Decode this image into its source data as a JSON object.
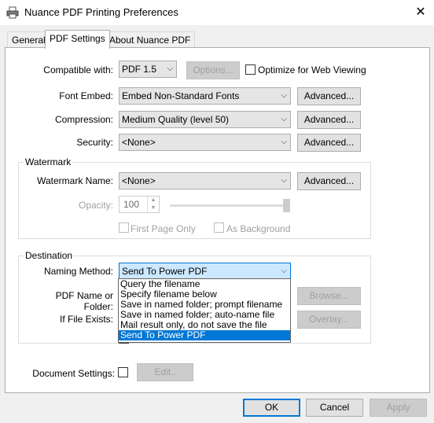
{
  "window": {
    "title": "Nuance PDF Printing Preferences"
  },
  "tabs": [
    "General",
    "PDF Settings",
    "About Nuance PDF"
  ],
  "compatible": {
    "label": "Compatible with:",
    "value": "PDF 1.5",
    "options_btn": "Options...",
    "optimize_label": "Optimize for Web Viewing"
  },
  "font_embed": {
    "label": "Font Embed:",
    "value": "Embed Non-Standard Fonts",
    "btn": "Advanced..."
  },
  "compression": {
    "label": "Compression:",
    "value": "Medium Quality (level 50)",
    "btn": "Advanced..."
  },
  "security": {
    "label": "Security:",
    "value": "<None>",
    "btn": "Advanced..."
  },
  "watermark": {
    "group_title": "Watermark",
    "name_label": "Watermark Name:",
    "name_value": "<None>",
    "btn": "Advanced...",
    "opacity_label": "Opacity:",
    "opacity_value": "100",
    "opacity_slider": 1.0,
    "first_page_label": "First Page Only",
    "background_label": "As Background"
  },
  "destination": {
    "group_title": "Destination",
    "naming_label": "Naming Method:",
    "naming_value": "Send To Power PDF",
    "pdfname_label": "PDF Name or Folder:",
    "browse_btn": "Browse...",
    "exists_label": "If File Exists:",
    "overlay_btn": "Overlay...",
    "options": [
      "Query the filename",
      "Specify filename below",
      "Save in named folder; prompt filename",
      "Save in named folder; auto-name file",
      "Mail result only, do not save the file",
      "Send To Power PDF"
    ],
    "selected_index": 5
  },
  "document_settings": {
    "label": "Document Settings:",
    "edit_btn": "Edit.."
  },
  "footer": {
    "ok": "OK",
    "cancel": "Cancel",
    "apply": "Apply"
  }
}
